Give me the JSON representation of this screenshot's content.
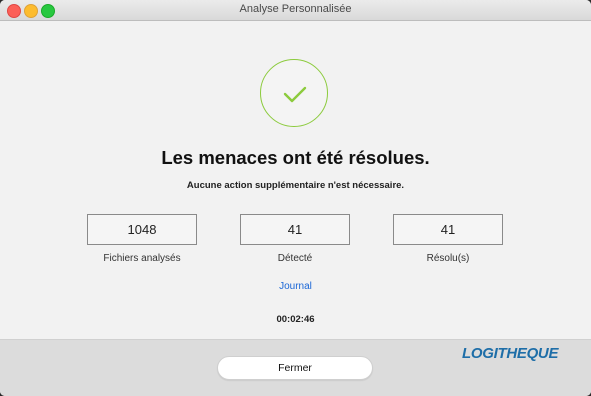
{
  "window": {
    "title": "Analyse Personnalisée"
  },
  "result": {
    "headline": "Les menaces ont été résolues.",
    "subline": "Aucune action supplémentaire n'est nécessaire.",
    "accent_color": "#8ccb3d"
  },
  "stats": [
    {
      "value": "1048",
      "label": "Fichiers analysés"
    },
    {
      "value": "41",
      "label": "Détecté"
    },
    {
      "value": "41",
      "label": "Résolu(s)"
    }
  ],
  "journal_link": "Journal",
  "elapsed_time": "00:02:46",
  "footer": {
    "close_label": "Fermer",
    "watermark": "LOGITHEQUE"
  }
}
